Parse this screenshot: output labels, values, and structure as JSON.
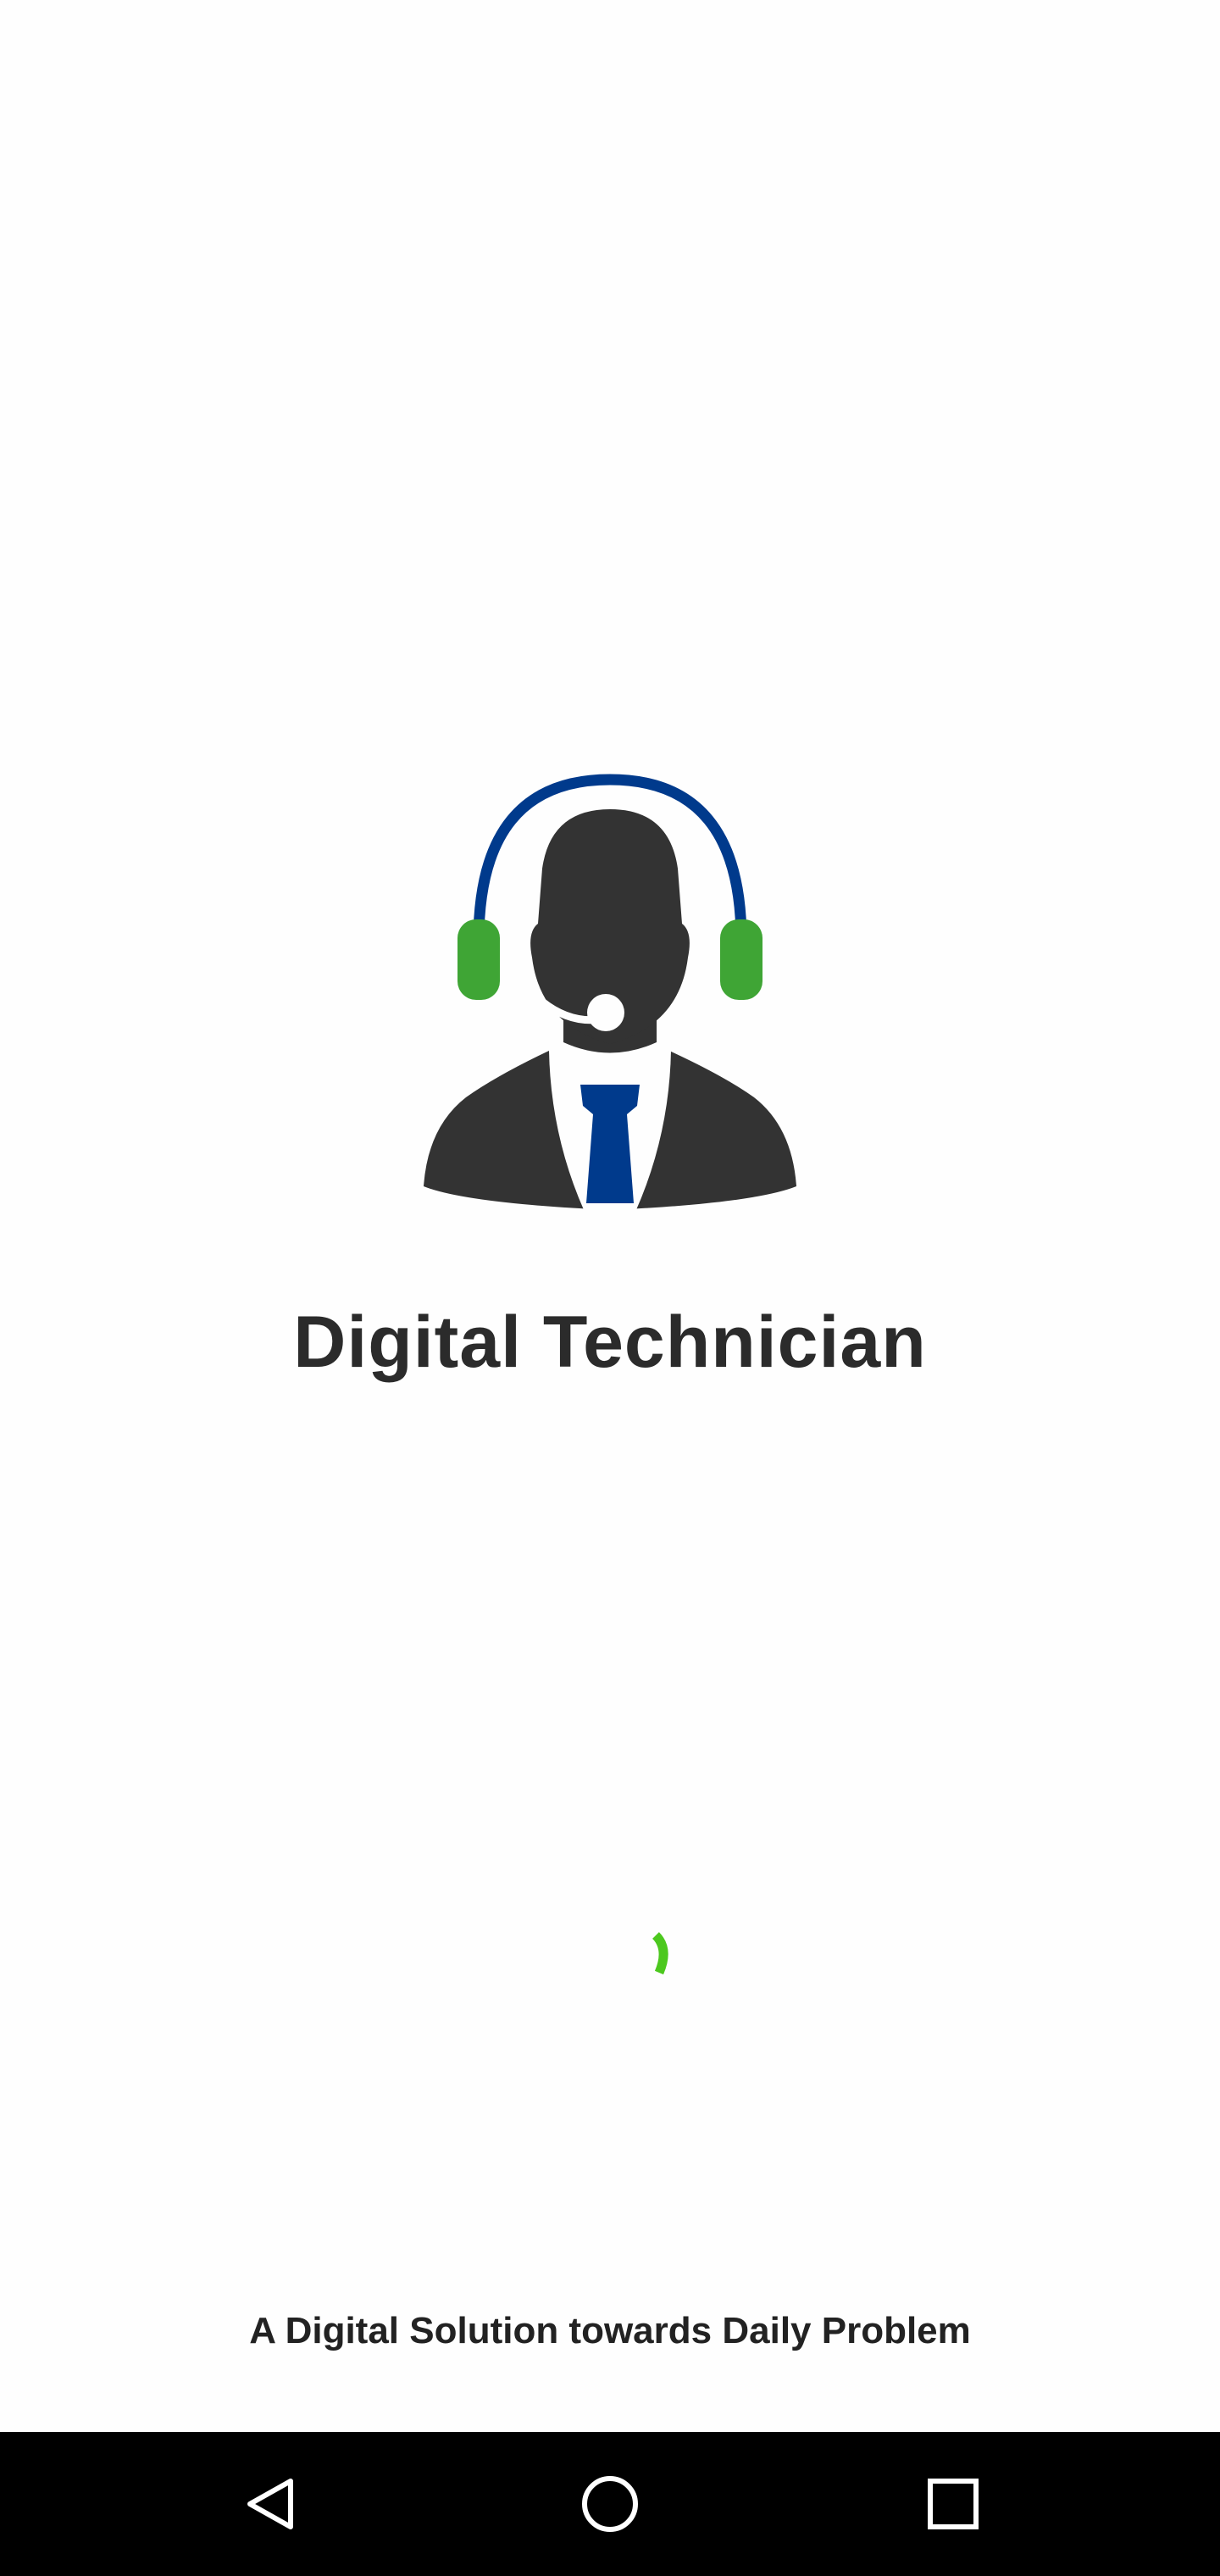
{
  "app": {
    "title": "Digital Technician",
    "tagline": "A Digital Solution towards Daily Problem"
  },
  "colors": {
    "background": "#fefefe",
    "figure": "#333333",
    "headset_band": "#003a8c",
    "ear_cups": "#3fa535",
    "tie": "#003a8c",
    "spinner": "#4cc81e",
    "navbar": "#000000"
  },
  "loading": {
    "indicator": "spinner"
  },
  "navbar": {
    "buttons": [
      {
        "icon": "back-triangle-icon"
      },
      {
        "icon": "home-circle-icon"
      },
      {
        "icon": "recents-square-icon"
      }
    ]
  }
}
